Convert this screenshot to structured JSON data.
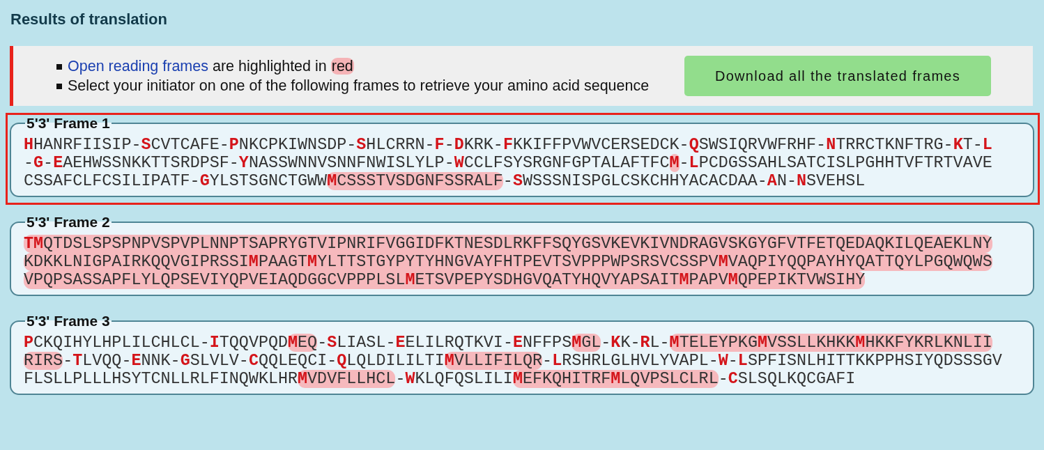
{
  "title": "Results of translation",
  "info": {
    "items": [
      {
        "kind": "link",
        "link": "Open reading frames",
        "text": "are highlighted in",
        "highlight": "red"
      },
      {
        "kind": "plain",
        "text": "Select your initiator on one of the following frames to retrieve your amino acid sequence"
      }
    ],
    "download_button": "Download all the translated frames"
  },
  "frames": [
    {
      "label": "5'3' Frame 1",
      "selected": true,
      "lines": [
        [
          {
            "text": "**H**HANRFIISIP-**S**CVTCAFE-**P**NKCPKIWNSDP-**S**HLCRRN-**F**-**D**KRK-**F**KKIFFPVWVCERSEDCK-**Q**SWSIQRVWFRHF-**N**TRRCTKNFTRG-**K**T-**L**",
            "highlighted": false
          }
        ],
        [
          {
            "text": "-**G**-**E**AEHWSSNKKTTSRDPSF-**Y**NASSWNNVSNNFNWISLYLP-**W**CCLFSYSRGNFGPTALAFTFC",
            "highlighted": false
          },
          {
            "text": "**M**",
            "highlighted": true
          },
          {
            "text": "-**L**PCDGSSAHLSATCISLPGHHTVFTRTVAVE",
            "highlighted": false
          }
        ],
        [
          {
            "text": "CSSAFCLFCSILIPATF-**G**YLSTSGNCTGWW",
            "highlighted": false
          },
          {
            "text": "**M**CSSSTVSDGNFSSRALF",
            "highlighted": true
          },
          {
            "text": "-**S**WSSSNISPGLCSKCHHYACACDAA-**A**N-**N**SVEHSL",
            "highlighted": false
          }
        ]
      ]
    },
    {
      "label": "5'3' Frame 2",
      "selected": false,
      "lines": [
        [
          {
            "text": "**TM**QTDSLSPSPNPVSPVPLNNPTSAPRYGTVIPNRIFVGGIDFKTNESDLRKFFSQYGSVKEVKIVNDRAGVSKGYGFVTFETQEDAQKILQEAEKLNY",
            "highlighted": true
          }
        ],
        [
          {
            "text": "KDKKLNIGPAIRKQQVGIPRSSI**M**PAAGT**M**YLTTSTGYPYTYHNGVAYFHTPEVTSVPPPWPSRSVCSSPV**M**VAQPIYQQPAYHYQATTQYLPGQWQWS",
            "highlighted": true
          }
        ],
        [
          {
            "text": "VPQPSASSAPFLYLQPSEVIYQPVEIAQDGGCVPPPLSL**M**ETSVPEPYSDHGVQATYHQVYAPSAIT**M**PAPV**M**QPEPIKTVWSIHY",
            "highlighted": true
          }
        ]
      ]
    },
    {
      "label": "5'3' Frame 3",
      "selected": false,
      "lines": [
        [
          {
            "text": "**P**CKQIHYLHPLILCHLCL-**I**TQQVPQD",
            "highlighted": false
          },
          {
            "text": "**M**EQ",
            "highlighted": true
          },
          {
            "text": "-**S**LIASL-**E**ELILRQTKVI-**E**NFFPS",
            "highlighted": false
          },
          {
            "text": "**M**GL",
            "highlighted": true
          },
          {
            "text": "-**K**K-**R**L-",
            "highlighted": false
          },
          {
            "text": "**M**TELEYPKG**M**VSSLLKHKK**M**HKKFYKRLKNLII",
            "highlighted": true
          }
        ],
        [
          {
            "text": "RIRS",
            "highlighted": true
          },
          {
            "text": "-**T**LVQQ-**E**NNK-**G**SLVLV-**C**QQLEQCI-**Q**LQLDILILTI",
            "highlighted": false
          },
          {
            "text": "**M**VLLIFILQR",
            "highlighted": true
          },
          {
            "text": "-**L**RSHRLGLHVLYVAPL-**W**-**L**SPFISNLHITTKKPPHSIYQDSSSGV",
            "highlighted": false
          }
        ],
        [
          {
            "text": "FLSLLPLLLHSYTCNLLRLFINQWKLHR",
            "highlighted": false
          },
          {
            "text": "**M**VDVFLLHCL",
            "highlighted": true
          },
          {
            "text": "-**W**KLQFQSLILI",
            "highlighted": false
          },
          {
            "text": "**M**EFKQHITRF**M**LQVPSLCLRL",
            "highlighted": true
          },
          {
            "text": "-**C**SLSQLKQCGAFI",
            "highlighted": false
          }
        ]
      ]
    }
  ]
}
